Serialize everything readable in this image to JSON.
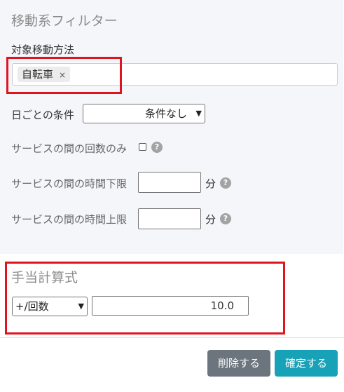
{
  "filter": {
    "title": "移動系フィルター",
    "transport_label": "対象移動方法",
    "selected_tag": "自転車",
    "tag_remove": "×",
    "daily_label": "日ごとの条件",
    "daily_value": "条件なし",
    "count_only_label": "サービスの間の回数のみ",
    "time_min_label": "サービスの間の時間下限",
    "time_max_label": "サービスの間の時間上限",
    "minutes_unit": "分",
    "help": "?"
  },
  "allowance": {
    "title": "手当計算式",
    "formula_option": "+/回数",
    "formula_value": "10.0"
  },
  "footer": {
    "delete_label": "削除する",
    "confirm_label": "確定する"
  },
  "colors": {
    "highlight": "#e0141e",
    "delete_button": "#6c757d",
    "confirm_button": "#17a2b8"
  },
  "icons": {
    "help": "question-circle-icon",
    "tag_remove": "close-icon",
    "select": "chevron-down-icon"
  }
}
